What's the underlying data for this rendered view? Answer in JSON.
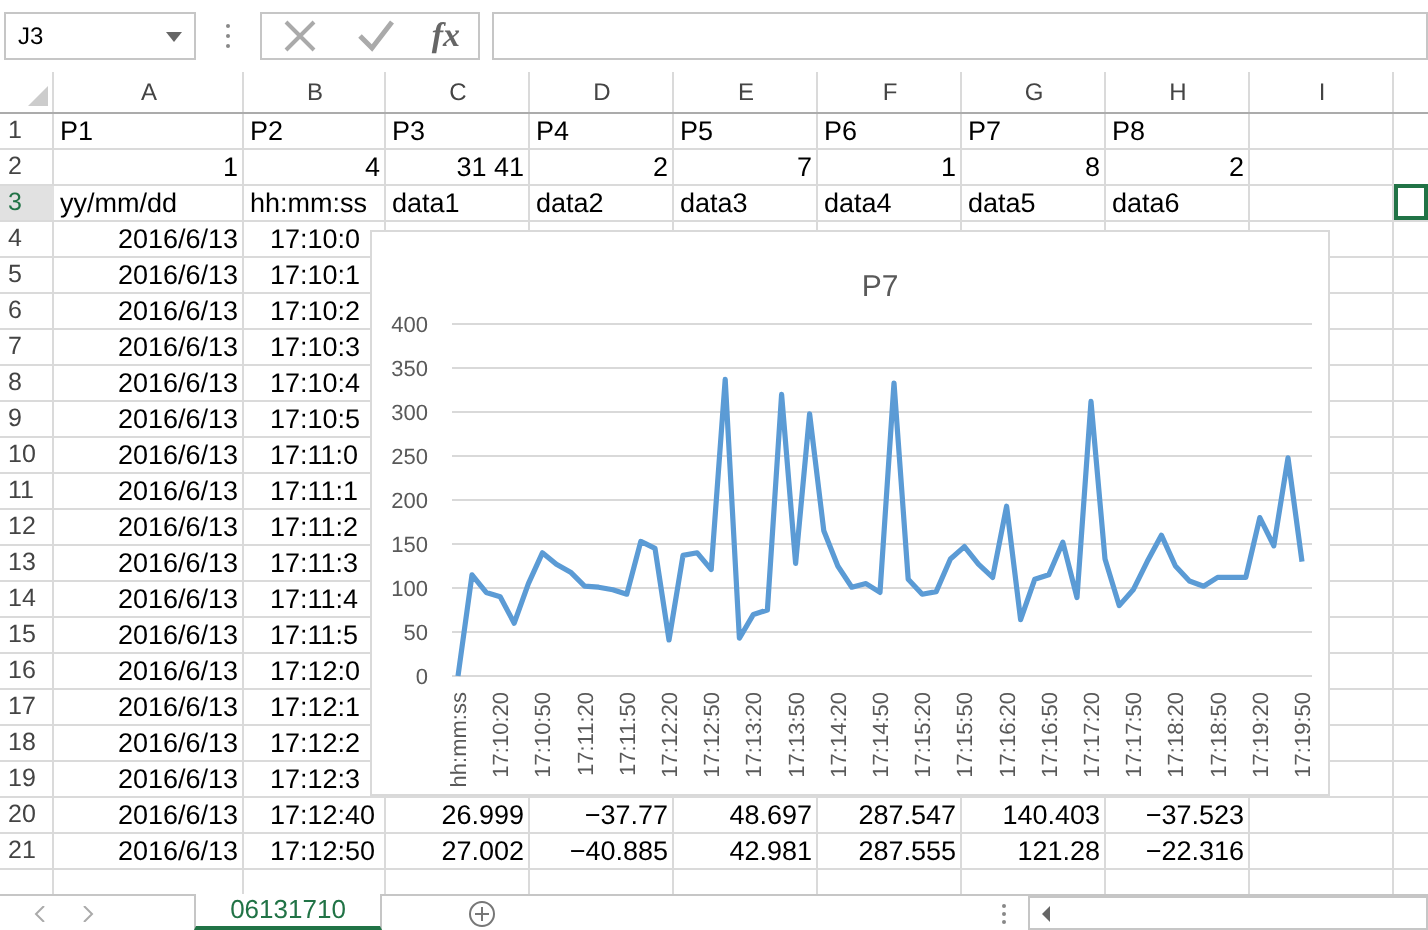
{
  "name_box": {
    "value": "J3"
  },
  "formula_bar": {
    "fx": "fx"
  },
  "columns": [
    {
      "label": "A",
      "selected": false
    },
    {
      "label": "B",
      "selected": false
    },
    {
      "label": "C",
      "selected": false
    },
    {
      "label": "D",
      "selected": false
    },
    {
      "label": "E",
      "selected": false
    },
    {
      "label": "F",
      "selected": false
    },
    {
      "label": "G",
      "selected": false
    },
    {
      "label": "H",
      "selected": false
    },
    {
      "label": "I",
      "selected": false
    }
  ],
  "rows": [
    {
      "number": "1",
      "kind": "text",
      "selected": false,
      "cells": [
        "P1",
        "P2",
        "P3",
        "P4",
        "P5",
        "P6",
        "P7",
        "P8"
      ]
    },
    {
      "number": "2",
      "kind": "number",
      "selected": false,
      "cells": [
        "1",
        "4",
        "31 41",
        "2",
        "7",
        "1",
        "8",
        "2"
      ]
    },
    {
      "number": "3",
      "kind": "text",
      "selected": true,
      "cells": [
        "yy/mm/dd",
        "hh:mm:ss",
        "data1",
        "data2",
        "data3",
        "data4",
        "data5",
        "data6"
      ]
    },
    {
      "number": "4",
      "kind": "data",
      "selected": false,
      "cells": [
        "2016/6/13",
        "17:10:0"
      ]
    },
    {
      "number": "5",
      "kind": "data",
      "selected": false,
      "cells": [
        "2016/6/13",
        "17:10:1"
      ]
    },
    {
      "number": "6",
      "kind": "data",
      "selected": false,
      "cells": [
        "2016/6/13",
        "17:10:2"
      ]
    },
    {
      "number": "7",
      "kind": "data",
      "selected": false,
      "cells": [
        "2016/6/13",
        "17:10:3"
      ]
    },
    {
      "number": "8",
      "kind": "data",
      "selected": false,
      "cells": [
        "2016/6/13",
        "17:10:4"
      ]
    },
    {
      "number": "9",
      "kind": "data",
      "selected": false,
      "cells": [
        "2016/6/13",
        "17:10:5"
      ]
    },
    {
      "number": "10",
      "kind": "data",
      "selected": false,
      "cells": [
        "2016/6/13",
        "17:11:0"
      ]
    },
    {
      "number": "11",
      "kind": "data",
      "selected": false,
      "cells": [
        "2016/6/13",
        "17:11:1"
      ]
    },
    {
      "number": "12",
      "kind": "data",
      "selected": false,
      "cells": [
        "2016/6/13",
        "17:11:2"
      ]
    },
    {
      "number": "13",
      "kind": "data",
      "selected": false,
      "cells": [
        "2016/6/13",
        "17:11:3"
      ]
    },
    {
      "number": "14",
      "kind": "data",
      "selected": false,
      "cells": [
        "2016/6/13",
        "17:11:4"
      ]
    },
    {
      "number": "15",
      "kind": "data",
      "selected": false,
      "cells": [
        "2016/6/13",
        "17:11:5"
      ]
    },
    {
      "number": "16",
      "kind": "data",
      "selected": false,
      "cells": [
        "2016/6/13",
        "17:12:0"
      ]
    },
    {
      "number": "17",
      "kind": "data",
      "selected": false,
      "cells": [
        "2016/6/13",
        "17:12:1"
      ]
    },
    {
      "number": "18",
      "kind": "data",
      "selected": false,
      "cells": [
        "2016/6/13",
        "17:12:2"
      ]
    },
    {
      "number": "19",
      "kind": "data",
      "selected": false,
      "cells": [
        "2016/6/13",
        "17:12:3"
      ]
    },
    {
      "number": "20",
      "kind": "data",
      "selected": false,
      "cells": [
        "2016/6/13",
        "17:12:40",
        "26.999",
        "−37.77",
        "48.697",
        "287.547",
        "140.403",
        "−37.523"
      ]
    },
    {
      "number": "21",
      "kind": "data",
      "selected": false,
      "cells": [
        "2016/6/13",
        "17:12:50",
        "27.002",
        "−40.885",
        "42.981",
        "287.555",
        "121.28",
        "−22.316"
      ]
    }
  ],
  "chart": {
    "chart_data": {
      "type": "line",
      "categories": [
        "hh:mm:ss",
        null,
        null,
        "17:10:20",
        null,
        null,
        "17:10:50",
        null,
        null,
        "17:11:20",
        null,
        null,
        "17:11:50",
        null,
        null,
        "17:12:20",
        null,
        null,
        "17:12:50",
        null,
        null,
        "17:13:20",
        null,
        null,
        "17:13:50",
        null,
        null,
        "17:14:20",
        null,
        null,
        "17:14:50",
        null,
        null,
        "17:15:20",
        null,
        null,
        "17:15:50",
        null,
        null,
        "17:16:20",
        null,
        null,
        "17:16:50",
        null,
        null,
        "17:17:20",
        null,
        null,
        "17:17:50",
        null,
        null,
        "17:18:20",
        null,
        null,
        "17:18:50",
        null,
        null,
        "17:19:20",
        null,
        null,
        "17:19:50"
      ],
      "series": [
        {
          "name": "P7",
          "color": "#5b9bd5",
          "values": [
            0,
            115,
            95,
            90,
            60,
            105,
            140,
            127,
            118,
            102,
            101,
            98,
            93,
            153,
            145,
            41,
            137,
            140,
            121,
            337,
            43,
            70,
            75,
            320,
            128,
            298,
            165,
            125,
            101,
            105,
            95,
            333,
            110,
            93,
            96,
            133,
            147,
            127,
            112,
            193,
            64,
            110,
            115,
            152,
            89,
            312,
            133,
            80,
            98,
            130,
            160,
            125,
            108,
            102,
            112,
            112,
            112,
            180,
            148,
            248,
            130
          ]
        }
      ],
      "ylim": [
        0,
        400
      ],
      "grid": true,
      "yticks": [
        0,
        50,
        100,
        150,
        200,
        250,
        300,
        350,
        400
      ]
    }
  },
  "sheet_tabs": [
    {
      "label": "06131710",
      "selected": true
    }
  ]
}
